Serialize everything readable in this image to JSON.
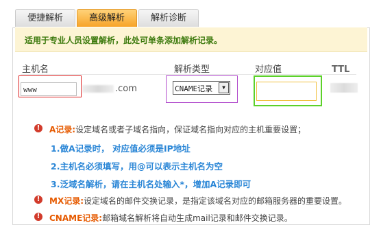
{
  "tabs": [
    {
      "label": "便捷解析",
      "active": false
    },
    {
      "label": "高级解析",
      "active": true
    },
    {
      "label": "解析诊断",
      "active": false
    }
  ],
  "banner": {
    "text": "适用于专业人员设置解析，此处可单条添加解析记录。"
  },
  "form": {
    "host_label": "主机名",
    "type_label": "解析类型",
    "value_label": "对应值",
    "ttl_label": "TTL",
    "host_value": "www",
    "domain_suffix": ".com",
    "type_selected": "CNAME记录",
    "value_value": "",
    "ttl_value": ""
  },
  "notes": {
    "a_keyword": "A记录:",
    "a_text": "设定域名或者子域名指向，保证域名指向对应的主机重要设置；",
    "sub1": "1.做A记录时， 对应值必须是IP地址",
    "sub2": "2.主机名必须填写，用@可以表示主机名为空",
    "sub3": "3.泛域名解析，请在主机名处输入*，增加A记录即可",
    "mx_keyword": "MX记录:",
    "mx_text": "设定域名的邮件交换记录，是指定该域名对应的邮箱服务器的重要设置。",
    "cname_keyword": "CNAME记录:",
    "cname_text": "邮箱域名解析将自动生成mail记录和邮件交换记录。"
  },
  "highlights": {
    "host_box": "#dd2222",
    "type_box": "#b14acc",
    "value_box": "#5cd12a",
    "banner_text": "#3d7a0e",
    "keyword": "#e65a00",
    "subtext": "#2a86d6"
  }
}
